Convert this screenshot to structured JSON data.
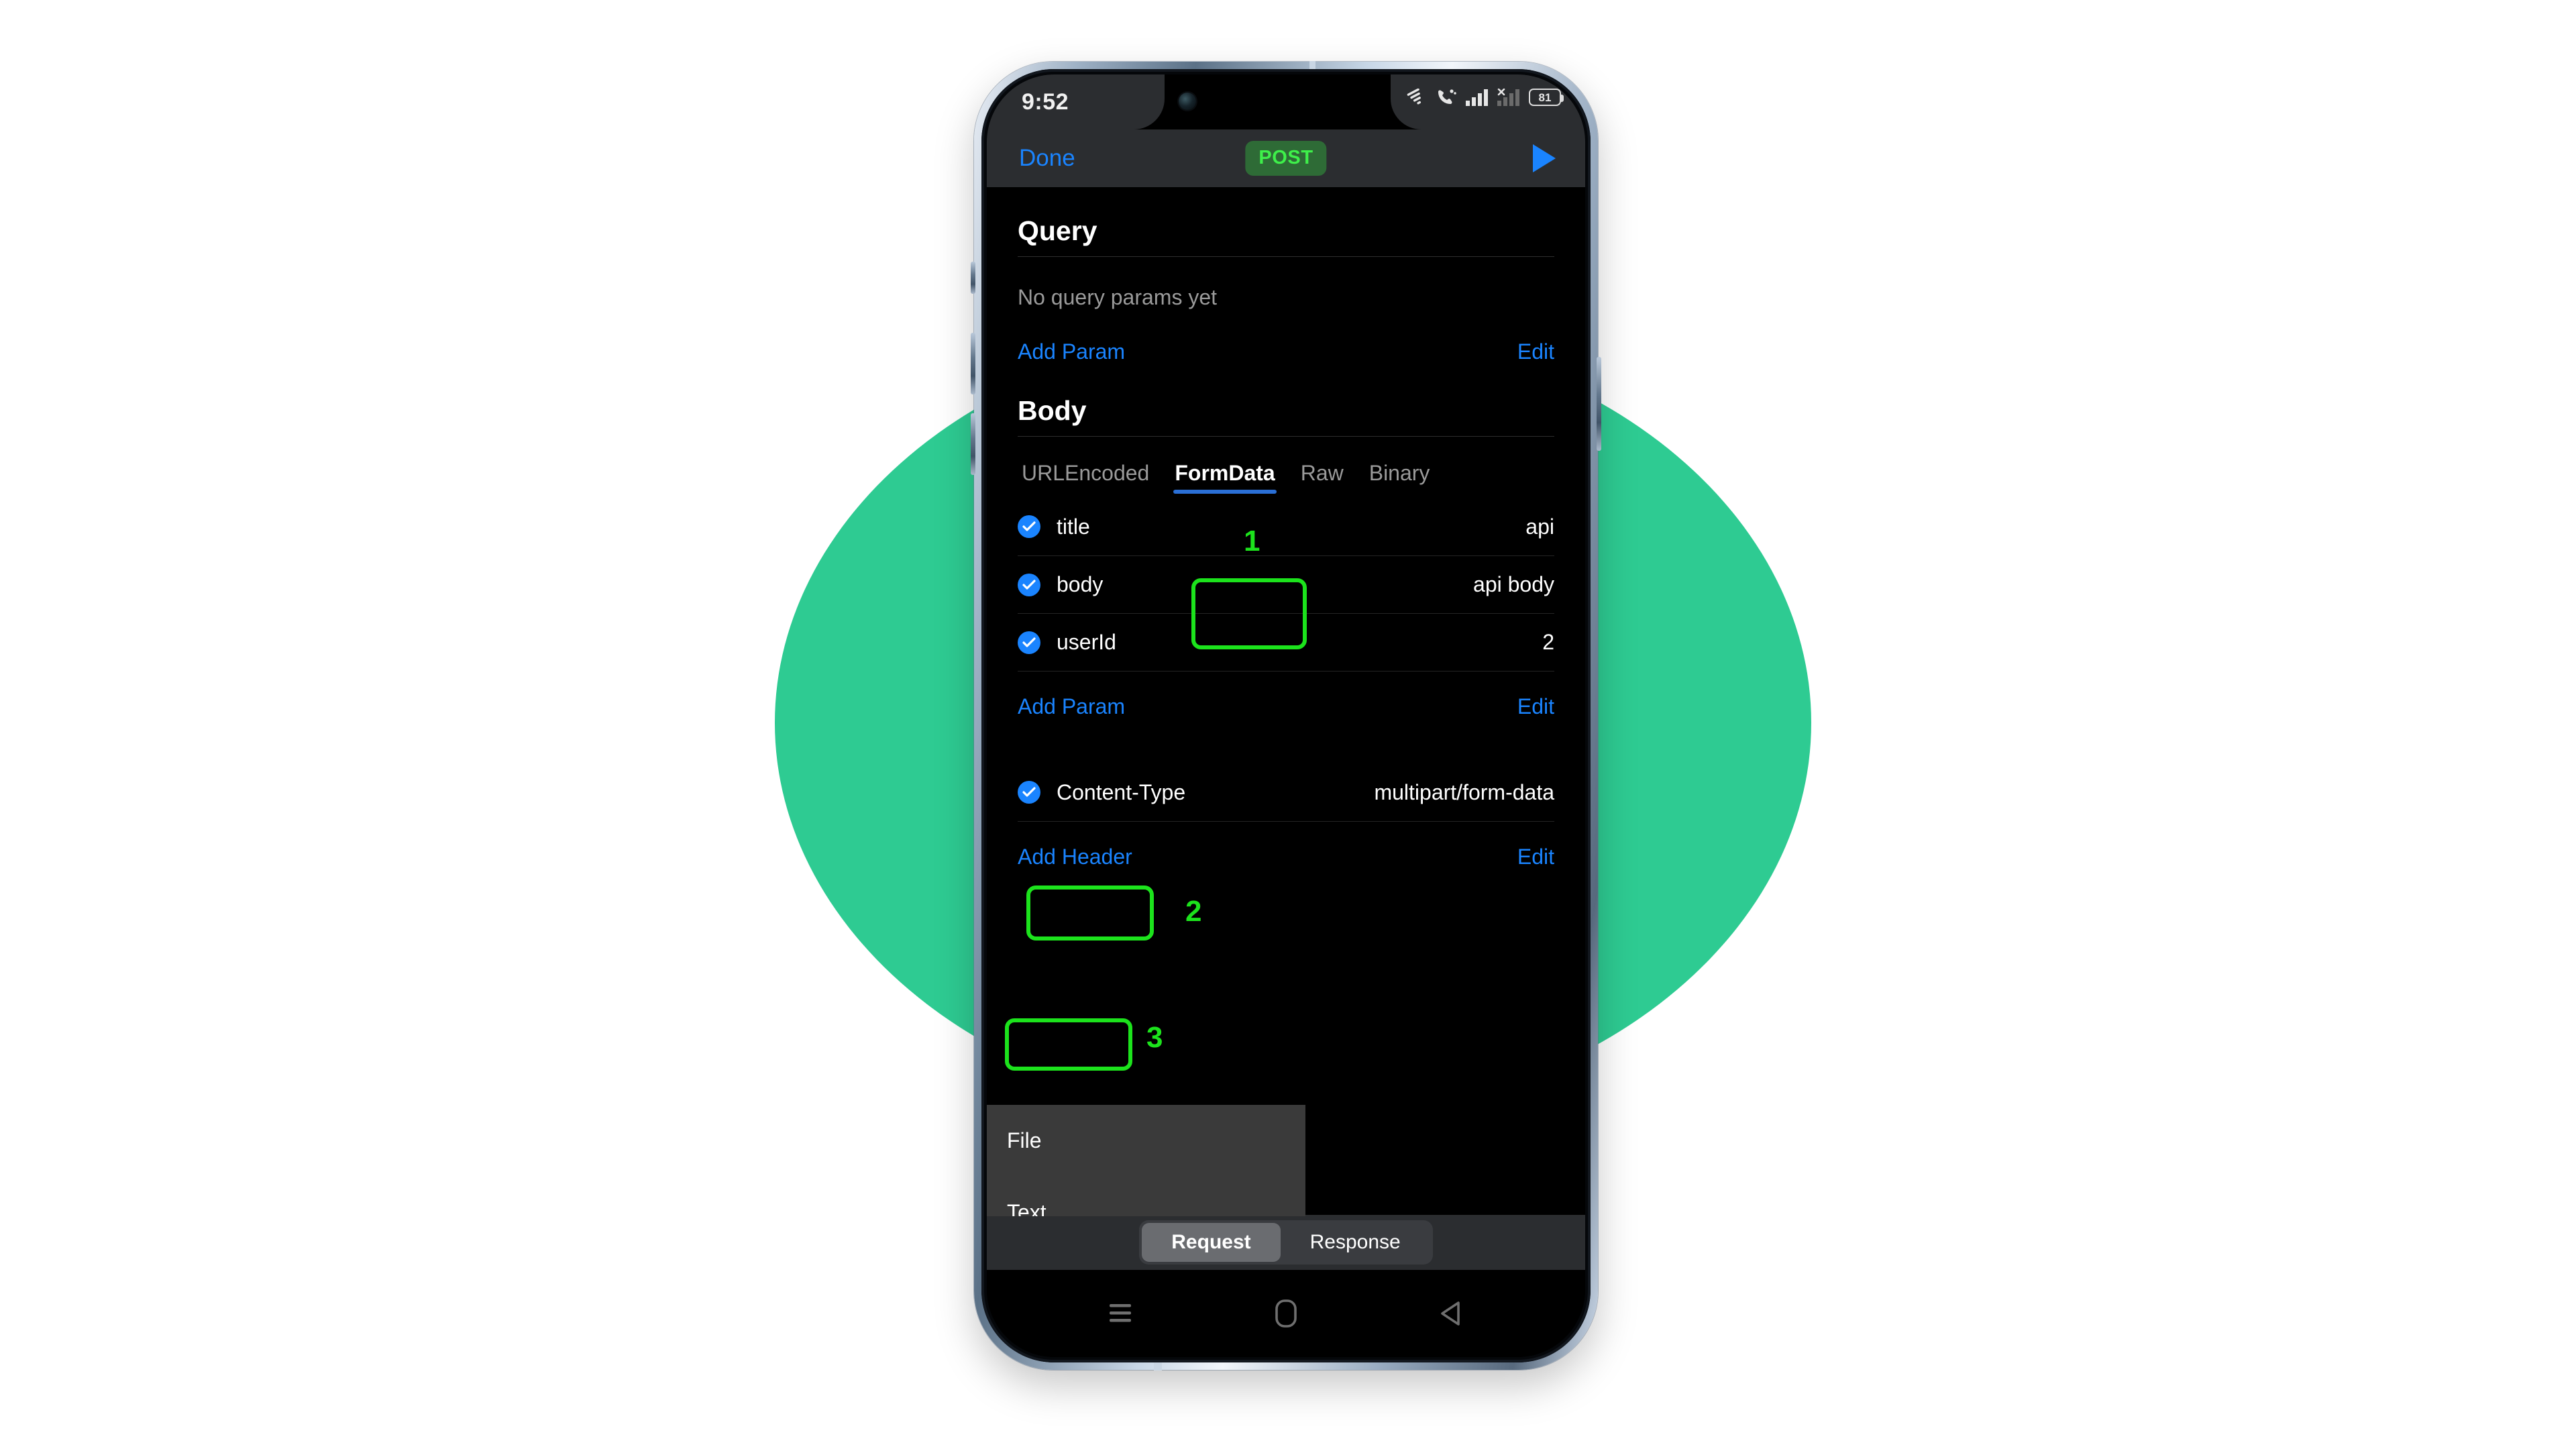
{
  "status_bar": {
    "time": "9:52",
    "battery_level": "81",
    "icons": [
      "wifi-icon",
      "call-icon",
      "signal-icon",
      "signal-off-icon",
      "battery-icon"
    ]
  },
  "nav_bar": {
    "done_label": "Done",
    "method": "POST",
    "send_icon": "send-play-icon"
  },
  "query_section": {
    "title": "Query",
    "empty_text": "No query params yet",
    "add_label": "Add Param",
    "edit_label": "Edit"
  },
  "body_section": {
    "title": "Body",
    "tabs": [
      {
        "label": "URLEncoded",
        "active": false
      },
      {
        "label": "FormData",
        "active": true
      },
      {
        "label": "Raw",
        "active": false
      },
      {
        "label": "Binary",
        "active": false
      }
    ],
    "params": [
      {
        "checked": true,
        "key": "title",
        "value": "api"
      },
      {
        "checked": true,
        "key": "body",
        "value": "api body"
      },
      {
        "checked": true,
        "key": "userId",
        "value": "2"
      }
    ],
    "add_label": "Add Param",
    "edit_label": "Edit"
  },
  "dropdown": {
    "items": [
      {
        "label": "File"
      },
      {
        "label": "Text"
      }
    ]
  },
  "headers_section": {
    "rows": [
      {
        "checked": true,
        "key": "Content-Type",
        "value": "multipart/form-data"
      }
    ],
    "add_label": "Add Header",
    "edit_label": "Edit"
  },
  "bottom_tabs": [
    {
      "label": "Request",
      "active": true
    },
    {
      "label": "Response",
      "active": false
    }
  ],
  "annotations": [
    {
      "number": "1",
      "target": "FormData tab"
    },
    {
      "number": "2",
      "target": "Add Param button"
    },
    {
      "number": "3",
      "target": "Text menu item"
    }
  ],
  "android_nav": [
    "recents-icon",
    "home-icon",
    "back-icon"
  ],
  "colors": {
    "accent_blue": "#1a84ff",
    "annotation_green": "#1ce31c",
    "background_circle_green": "#2ecb92",
    "method_badge_bg": "#2e6b36",
    "method_badge_text": "#3ef04a"
  }
}
